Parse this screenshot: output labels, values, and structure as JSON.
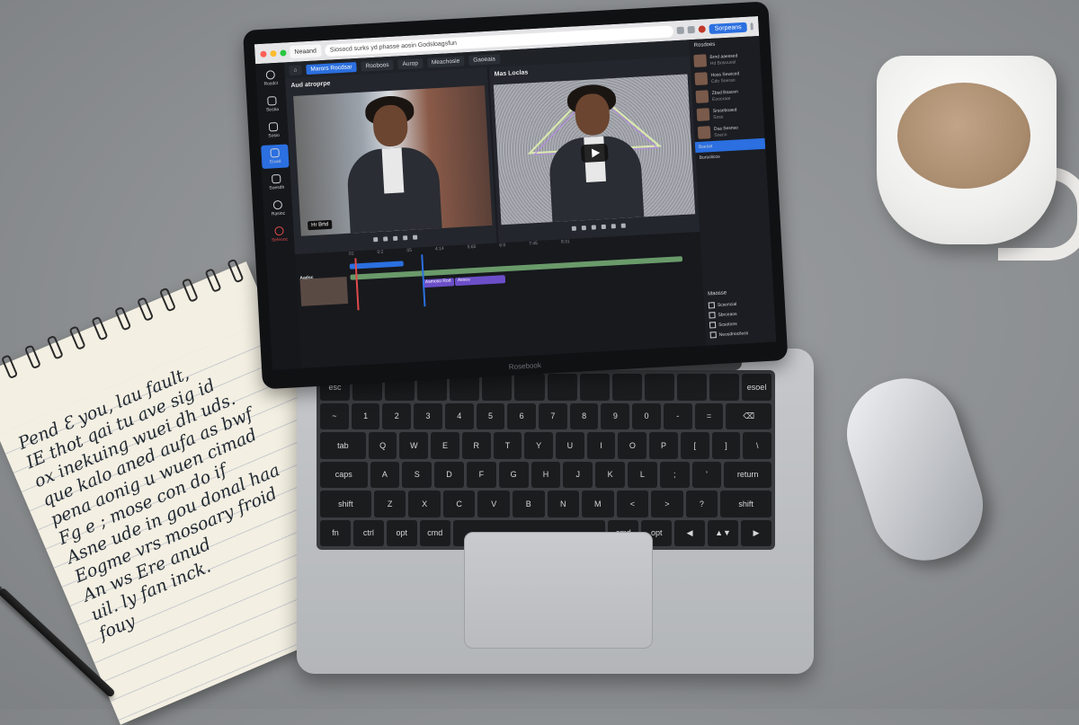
{
  "notebook": {
    "text": "Pend  Ɛ  you, lau fault,\nIE thot  qai tu  ave sig  id\nox inekuing  wuei  dh  uds.\nque kalo aned  aufa  as  bwf\npena  aonig u wuen  cimad\nFg  e ; mose con  do  if\nAsne  ude in  gou  donal haa\nEogme  vrs  mosoary   froid\nAn  ws  Ere  anud\nuil. ly  fan  inck.\n                 fouy"
  },
  "laptop": {
    "brand": "Rosebook",
    "browser": {
      "tab_label": "Neaand",
      "url": "Siosocd surks yd phasse aosin Godsloagsfun",
      "signin_label": "Sorpeans"
    },
    "toolbar": {
      "btn_1": "Marors Rocdsar",
      "btn_2": "Rooboos",
      "btn_3": "Aurop",
      "btn_4": "Meachosie",
      "btn_5": "Gaoeaia"
    },
    "rail": [
      {
        "label": "Rosdct"
      },
      {
        "label": "Sestia"
      },
      {
        "label": "Sosio"
      },
      {
        "label": "Eixad"
      },
      {
        "label": "Soesdh"
      },
      {
        "label": "Rasinc"
      },
      {
        "label": "Seleooc"
      }
    ],
    "preview_left": {
      "title": "Aud atroprpe",
      "badge": "Hr Brtd"
    },
    "preview_right": {
      "title": "Mas Loclas"
    },
    "timeline": {
      "ruler": [
        "01",
        "0:2",
        "05",
        "4:14",
        "5:65",
        "6:0",
        "7:45",
        "8:31"
      ],
      "clip_1": "Asmoso Rod",
      "clip_2": "Aescu",
      "row_label": "Aadsc"
    },
    "side_panel": {
      "title": "Rosdoes",
      "items": [
        {
          "name": "Brnd aaessed",
          "sub": "Hd Bosouosl"
        },
        {
          "name": "Hoss Sewiced",
          "sub": "Cdo Soerao"
        },
        {
          "name": "Zbsd Bsaoxn",
          "sub": "Eoooraar"
        },
        {
          "name": "Srsseboaed",
          "sub": "Soss"
        },
        {
          "name": "Dsa Sesnso",
          "sub": "Soeco"
        }
      ],
      "selected": "Bsesat",
      "extra": "Borsolicos",
      "group_title": "Maosse",
      "checks": [
        "Scsencial",
        "Sbrceaos",
        "Scsotons",
        "Neosdnociless"
      ]
    },
    "keyboard": {
      "rows": [
        [
          "esc",
          "",
          "",
          "",
          "",
          "",
          "",
          "",
          "",
          "",
          "",
          "",
          "",
          "esoel"
        ],
        [
          "~",
          "1",
          "2",
          "3",
          "4",
          "5",
          "6",
          "7",
          "8",
          "9",
          "0",
          "-",
          "=",
          "⌫"
        ],
        [
          "tab",
          "Q",
          "W",
          "E",
          "R",
          "T",
          "Y",
          "U",
          "I",
          "O",
          "P",
          "[",
          "]",
          "\\"
        ],
        [
          "caps",
          "A",
          "S",
          "D",
          "F",
          "G",
          "H",
          "J",
          "K",
          "L",
          ";",
          "'",
          "return"
        ],
        [
          "shift",
          "Z",
          "X",
          "C",
          "V",
          "B",
          "N",
          "M",
          "<",
          ">",
          "?",
          "shift"
        ],
        [
          "fn",
          "ctrl",
          "opt",
          "cmd",
          "",
          "cmd",
          "opt",
          "◀",
          "▲▼",
          "▶"
        ]
      ]
    }
  }
}
